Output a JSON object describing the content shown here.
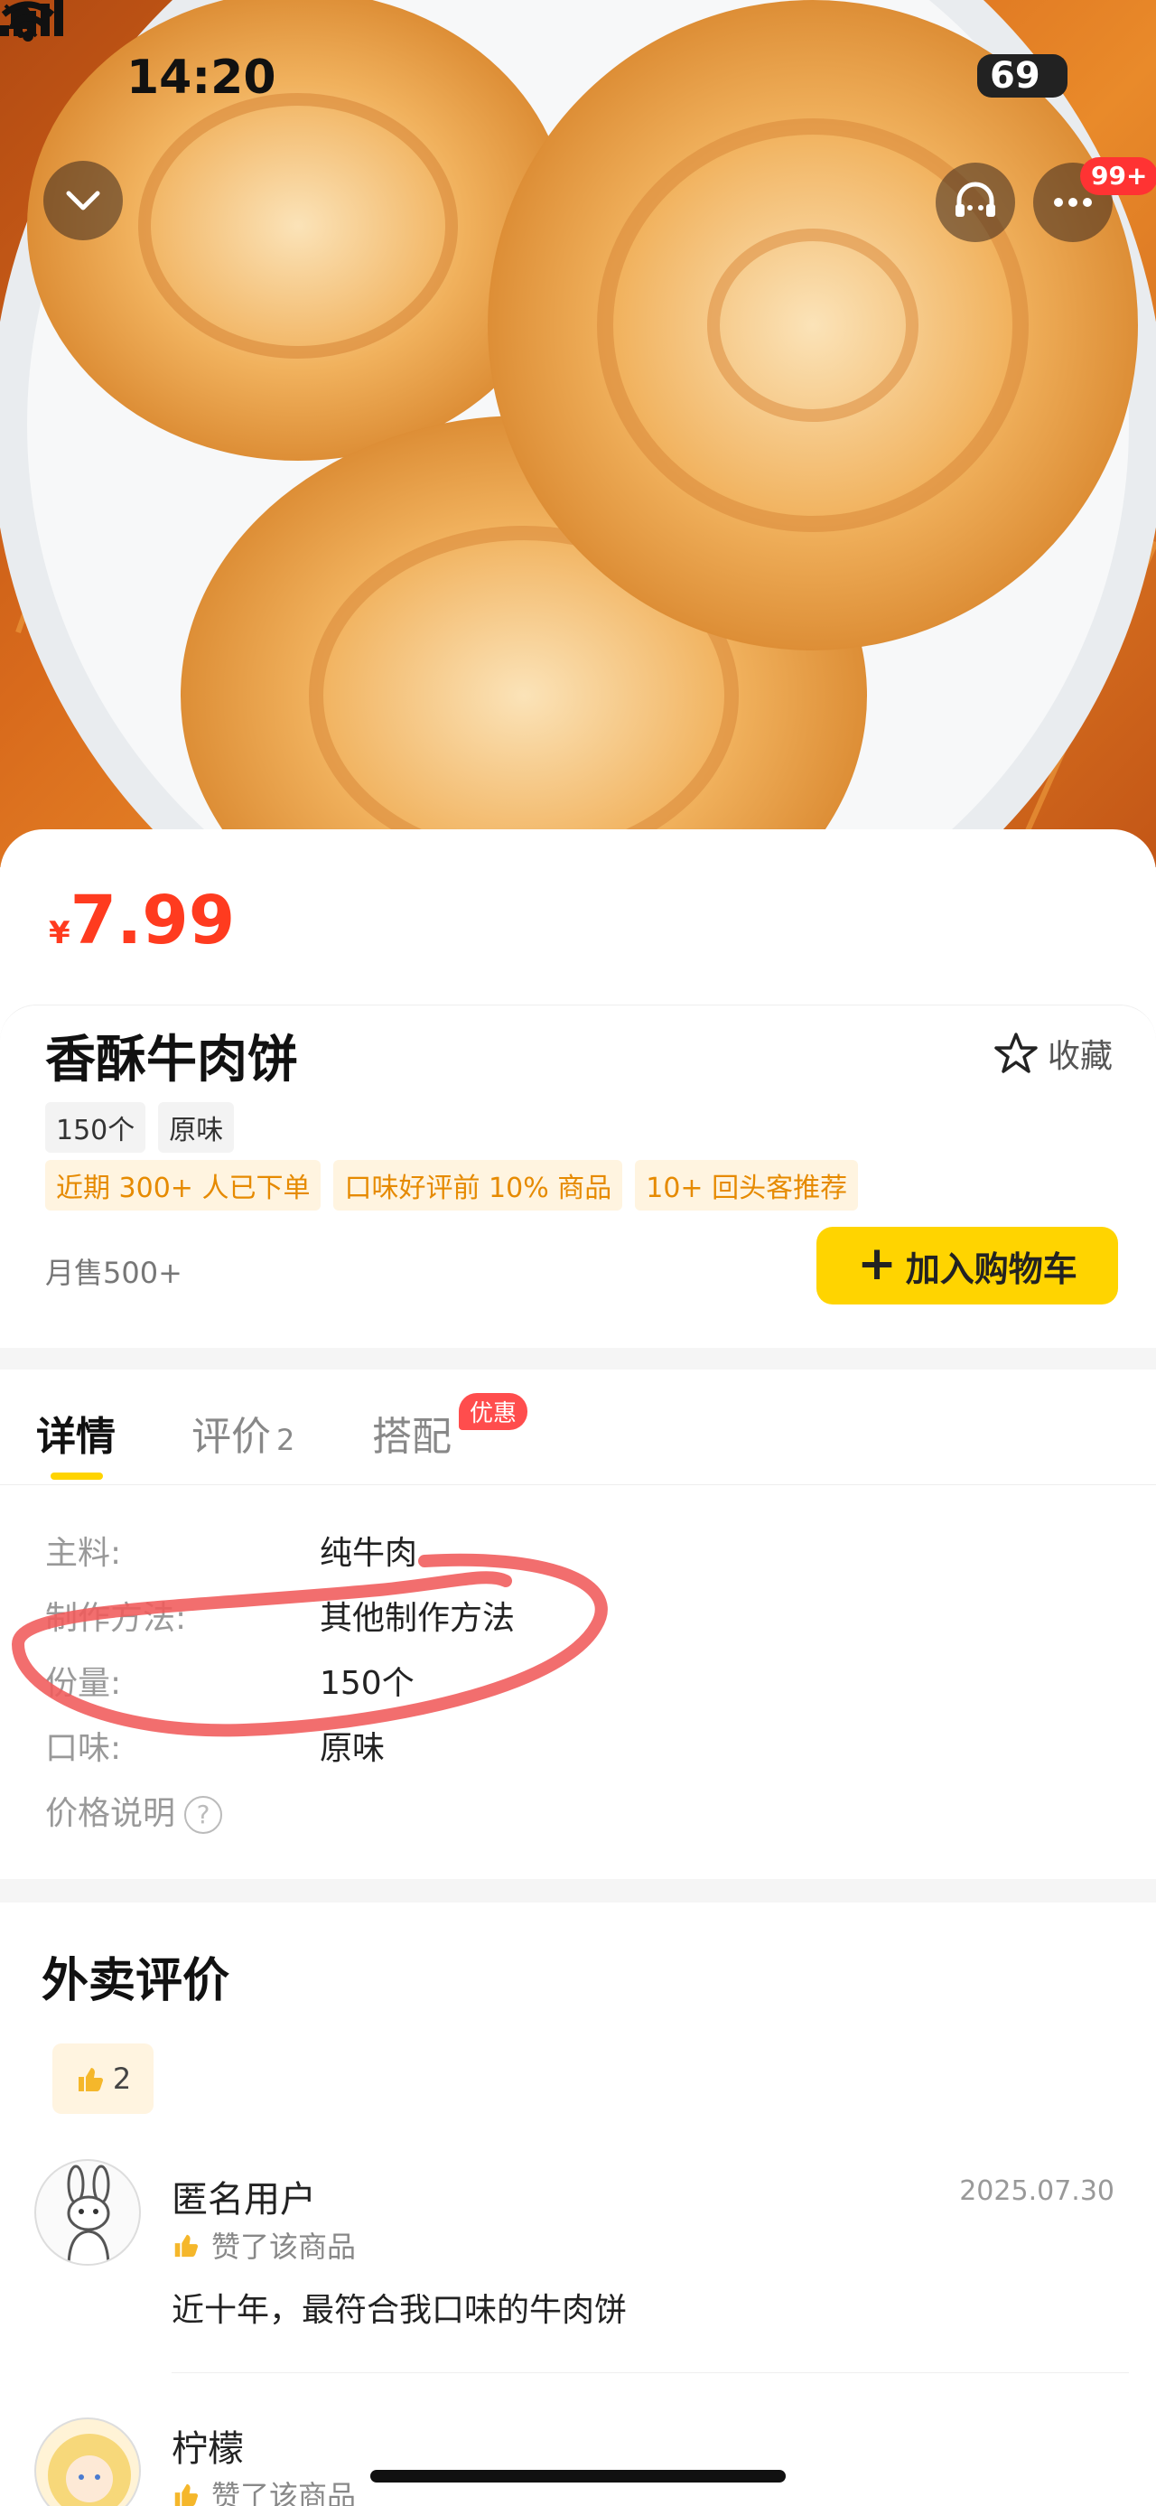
{
  "status_bar": {
    "time": "14:20",
    "battery": "69"
  },
  "hero": {
    "more_badge": "99+"
  },
  "product": {
    "price_symbol": "¥",
    "price": "7.99",
    "name": "香酥牛肉饼",
    "favorite_label": "收藏",
    "spec_tags": [
      "150个",
      "原味"
    ],
    "promo_tags": [
      "近期 300+ 人已下单",
      "口味好评前 10% 商品",
      "10+ 回头客推荐"
    ],
    "monthly_sales": "月售500+",
    "add_to_cart": "加入购物车"
  },
  "tabs": {
    "items": [
      {
        "label": "详情",
        "active": true
      },
      {
        "label": "评价",
        "count": "2"
      },
      {
        "label": "搭配",
        "badge": "优惠"
      }
    ]
  },
  "details": {
    "rows": [
      {
        "label": "主料:",
        "value": "纯牛肉"
      },
      {
        "label": "制作方法:",
        "value": "其他制作方法"
      },
      {
        "label": "份量:",
        "value": "150个"
      },
      {
        "label": "口味:",
        "value": "原味"
      }
    ],
    "price_note": "价格说明",
    "help_symbol": "?"
  },
  "reviews": {
    "title": "外卖评价",
    "likes_count": "2",
    "items": [
      {
        "user": "匿名用户",
        "date": "2025.07.30",
        "liked": "赞了该商品",
        "text": "近十年，最符合我口味的牛肉饼"
      },
      {
        "user": "柠檬",
        "liked": "赞了该商品"
      }
    ]
  },
  "colors": {
    "accent_yellow": "#ffd400",
    "price_red": "#ff3b1f",
    "promo_orange": "#e68a00"
  }
}
